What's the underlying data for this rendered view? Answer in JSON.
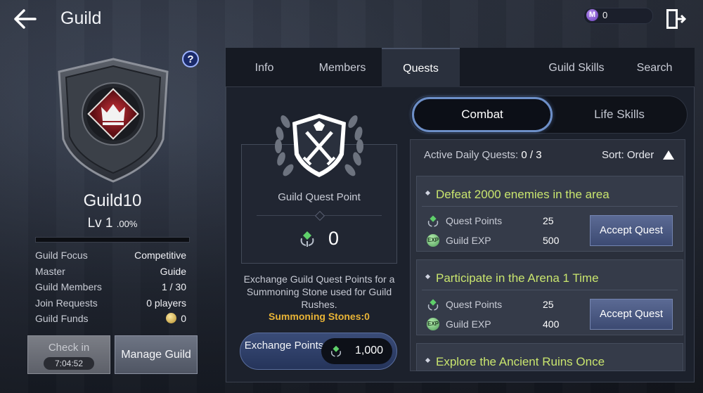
{
  "header": {
    "title": "Guild",
    "currency_value": "0",
    "currency_icon": "M"
  },
  "guild": {
    "name": "Guild10",
    "level_label": "Lv 1",
    "level_pct": ".00%",
    "exp_fraction": 0,
    "stats": [
      {
        "key": "Guild Focus",
        "value": "Competitive"
      },
      {
        "key": "Master",
        "value": "Guide"
      },
      {
        "key": "Guild Members",
        "value": "1 / 30"
      },
      {
        "key": "Join Requests",
        "value": "0 players"
      },
      {
        "key": "Guild Funds",
        "value": "0"
      }
    ],
    "checkin_label": "Check in",
    "checkin_timer": "7:04:52",
    "manage_label": "Manage Guild",
    "help_label": "?"
  },
  "tabs": [
    "Info",
    "Members",
    "Quests",
    "Guild Skills",
    "Search"
  ],
  "active_tab": "Quests",
  "quest_point": {
    "label": "Guild Quest Point",
    "value": "0",
    "exchange_text": "Exchange Guild Quest Points for a Summoning Stone used for Guild Rushes.",
    "summoning_label": "Summoning Stones:0",
    "exchange_btn": "Exchange Points",
    "exchange_cost": "1,000"
  },
  "segments": {
    "combat": "Combat",
    "life": "Life Skills"
  },
  "quest_list": {
    "active_label": "Active Daily Quests:",
    "active_count": "0 / 3",
    "sort_label": "Sort: Order",
    "quests": [
      {
        "title": "Defeat 2000 enemies in the area",
        "qp_label": "Quest Points",
        "qp": "25",
        "exp_label": "Guild EXP",
        "exp": "500",
        "button": "Accept Quest"
      },
      {
        "title": "Participate in the Arena 1 Time",
        "qp_label": "Quest Points",
        "qp": "25",
        "exp_label": "Guild EXP",
        "exp": "400",
        "button": "Accept Quest"
      },
      {
        "title": "Explore the Ancient Ruins Once"
      }
    ]
  },
  "colors": {
    "accent_quest_title": "#c9e56e",
    "summon_gold": "#e9b436",
    "combat_border": "#6d8fc8"
  }
}
